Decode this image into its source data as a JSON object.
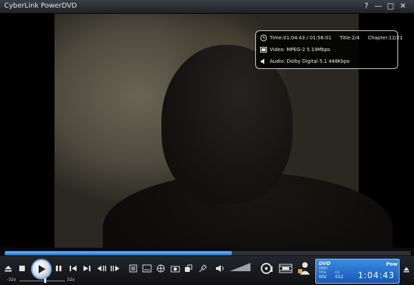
{
  "window": {
    "title": "CyberLink PowerDVD",
    "help_label": "?",
    "min_label": "—",
    "max_label": "□",
    "close_label": "✕"
  },
  "osd": {
    "time": "Time:01:04:43 / 01:56:01",
    "title": "Title:2/4",
    "chapter": "Chapter:12/21",
    "video": "Video: MPEG-2  5.19Mbps",
    "audio": "Audio: Dolby Digital 5.1   448Kbps"
  },
  "seek": {
    "progress": 0.56
  },
  "speed": {
    "min_label": "-32x",
    "max_label": "32x"
  },
  "dvd": {
    "logo": "DVD",
    "sub": "VIDEO",
    "brand": "Pow",
    "title_label": "TITLE",
    "title_value": "002",
    "chapter_label": "CH",
    "chapter_value": "012",
    "time": "1:04:43"
  },
  "colors": {
    "accent": "#1e74d8",
    "panel": "#1558b8"
  }
}
